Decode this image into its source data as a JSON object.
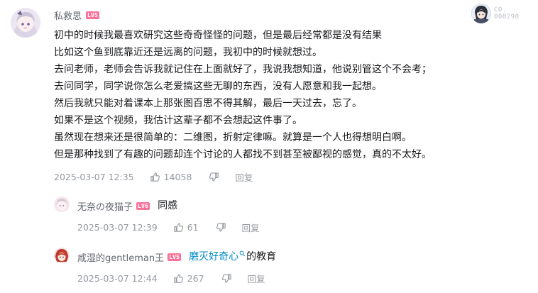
{
  "main_comment": {
    "username": "私救思",
    "level": "LV5",
    "lines": [
      "初中的时候我最喜欢研究这些奇奇怪怪的问题，但是最后经常都是没有结果",
      "比如这个鱼到底靠近还是远离的问题，我初中的时候就想过。",
      "去问老师，老师会告诉我就记住在上面就好了，我说我想知道，他说别管这个不会考；",
      "去问同学，同学说你怎么老爱搞这些无聊的东西，没有人愿意和我一起想。",
      "然后我就只能对着课本上那张图百思不得其解，最后一天过去，忘了。",
      "如果不是这个视频，我估计这辈子都不会想起这件事了。",
      "虽然现在想来还是很简单的：二维图，折射定律嘛。就算是一个人也得想明白啊。",
      "但是那种找到了有趣的问题却连个讨论的人都找不到甚至被鄙视的感觉，真的不太好。"
    ],
    "timestamp": "2025-03-07 12:35",
    "likes": "14058",
    "reply_label": "回复",
    "medal_line1": "CO.",
    "medal_line2": "008290"
  },
  "replies": [
    {
      "username": "无奈の夜猫子",
      "level": "LV6",
      "text": "同感",
      "timestamp": "2025-03-07 12:39",
      "likes": "61",
      "reply_label": "回复"
    },
    {
      "username": "咸湿的gentleman王",
      "level": "LV5",
      "link_text": "磨灭好奇心",
      "text_after": "的教育",
      "timestamp": "2025-03-07 12:44",
      "likes": "267",
      "reply_label": "回复"
    }
  ],
  "colors": {
    "level_badge": "#fb7299",
    "link": "#008ac5",
    "meta": "#9499a0"
  }
}
